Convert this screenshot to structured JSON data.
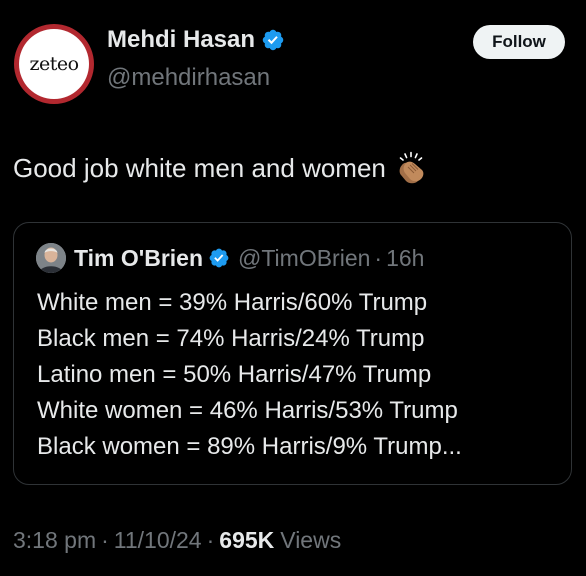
{
  "author": {
    "avatar_text": "zeteo",
    "display_name": "Mehdi Hasan",
    "handle": "@mehdirhasan",
    "verified_icon": "verified-badge-icon"
  },
  "follow_label": "Follow",
  "tweet": {
    "text": "Good job white men and women",
    "emoji_icon": "clapping-hands-icon"
  },
  "quoted": {
    "display_name": "Tim O'Brien",
    "handle": "@TimOBrien",
    "separator": "·",
    "time": "16h",
    "lines": [
      "White men = 39% Harris/60% Trump",
      "Black men = 74% Harris/24% Trump",
      "Latino men = 50% Harris/47% Trump",
      "White women = 46% Harris/53% Trump",
      "Black women = 89% Harris/9% Trump..."
    ]
  },
  "meta": {
    "time": "3:18 pm",
    "separator": "·",
    "date": "11/10/24",
    "views_count": "695K",
    "views_label": "Views"
  },
  "colors": {
    "background": "#000000",
    "text": "#e7e9ea",
    "secondary": "#71767b",
    "verified": "#1d9bf0",
    "avatar_ring": "#b2282f"
  }
}
